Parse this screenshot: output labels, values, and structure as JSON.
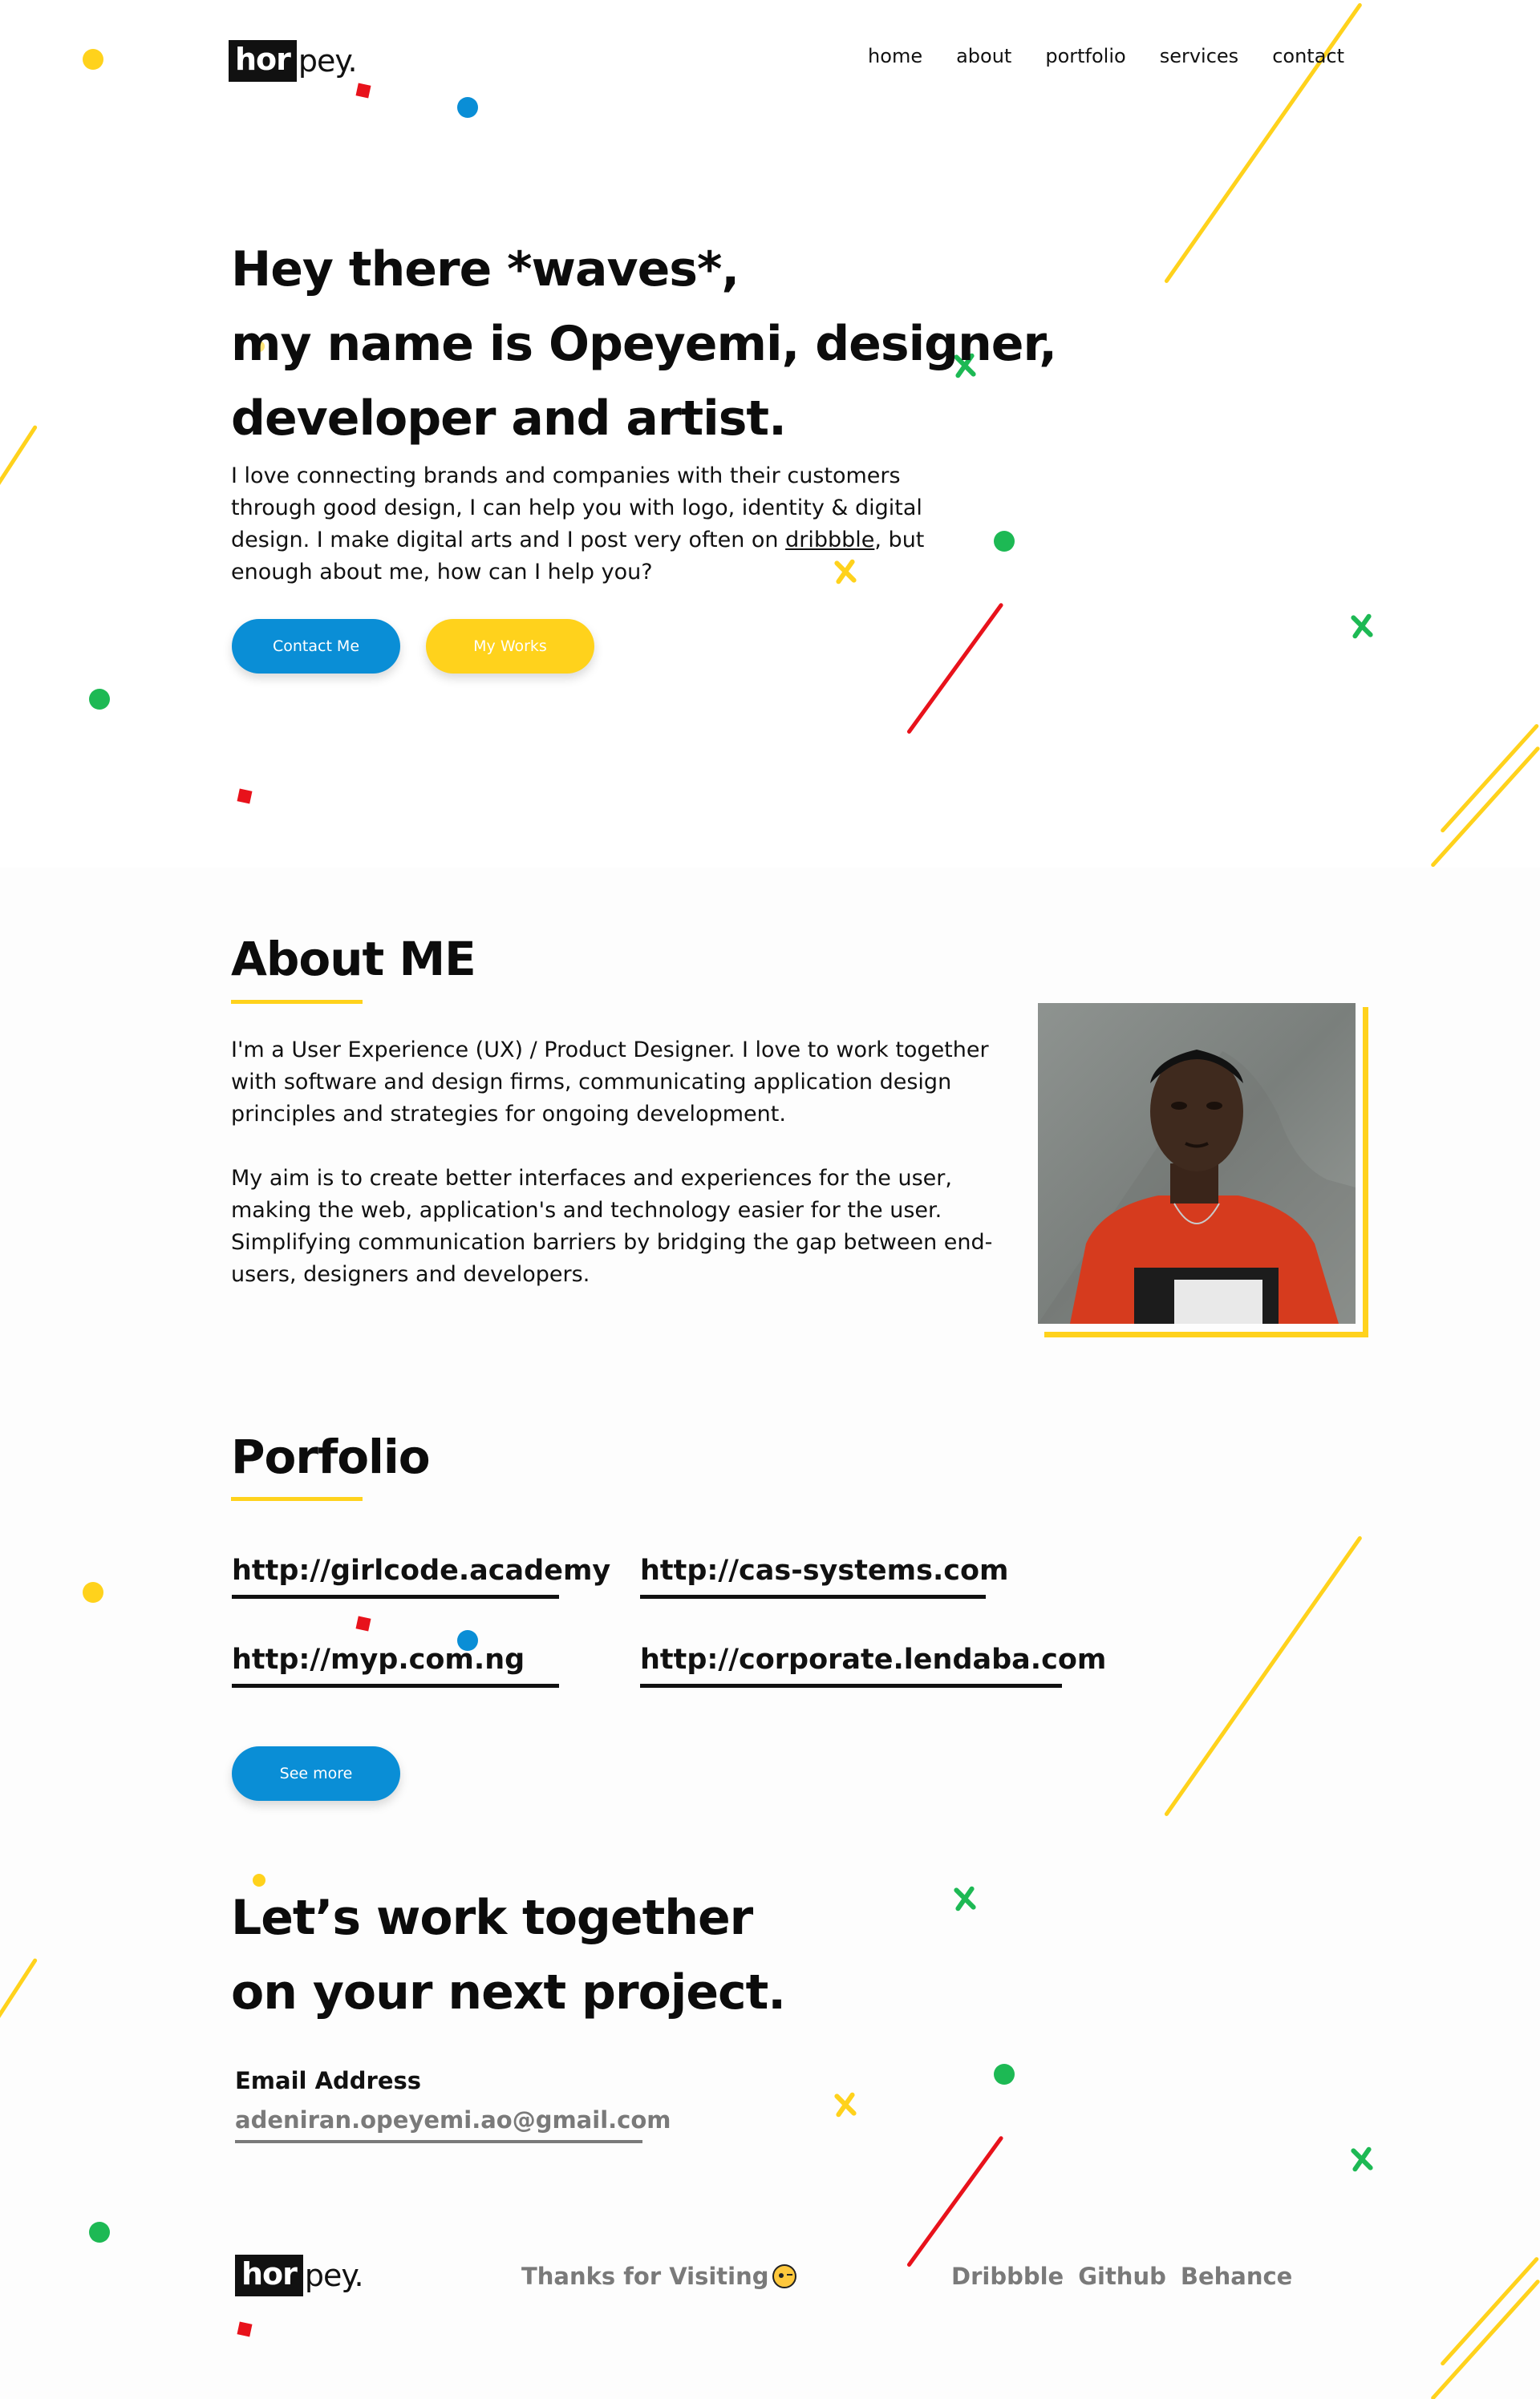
{
  "logo": {
    "box_text": "hor",
    "tail_text": "pey."
  },
  "nav": {
    "items": [
      {
        "label": "home"
      },
      {
        "label": "about"
      },
      {
        "label": "portfolio"
      },
      {
        "label": "services"
      },
      {
        "label": "contact"
      }
    ]
  },
  "hero": {
    "heading_lines": [
      "Hey there *waves*,",
      "my name is Opeyemi, designer,",
      "developer and artist."
    ],
    "intro_before_link": "I love connecting brands and companies with their customers through good design, I can help you with logo, identity & digital design. I make digital arts and I post very often on ",
    "intro_link": "dribbble",
    "intro_after_link": ", but enough about me, how can I help you?",
    "contact_button": "Contact Me",
    "works_button": "My Works"
  },
  "about": {
    "title": "About ME",
    "paragraphs": [
      "I'm a User Experience (UX) / Product Designer. I love to work together with software and design firms, communicating application design principles and strategies for ongoing development.",
      "My aim is to create better interfaces and experiences for the user, making the web, application's and technology easier for the user. Simplifying communication barriers by bridging the gap between end-users, designers and developers."
    ]
  },
  "portfolio": {
    "title": "Porfolio",
    "links": [
      "http://girlcode.academy",
      "http://cas-systems.com",
      "http://myp.com.ng",
      "http://corporate.lendaba.com"
    ],
    "see_more": "See more"
  },
  "contact": {
    "heading_lines": [
      "Let’s work together",
      "on your next project."
    ],
    "email_label": "Email Address",
    "email_value": "adeniran.opeyemi.ao@gmail.com"
  },
  "footer": {
    "thanks": "Thanks for Visiting",
    "emoji_icon": "winking-kiss-face-icon",
    "links": [
      "Dribbble",
      "Github",
      "Behance"
    ]
  },
  "colors": {
    "accent_yellow": "#ffd21c",
    "accent_blue": "#0a8ed6",
    "accent_green": "#1db954",
    "accent_red": "#e8121b",
    "text_dark": "#111111",
    "text_muted": "#7a7a7a"
  }
}
